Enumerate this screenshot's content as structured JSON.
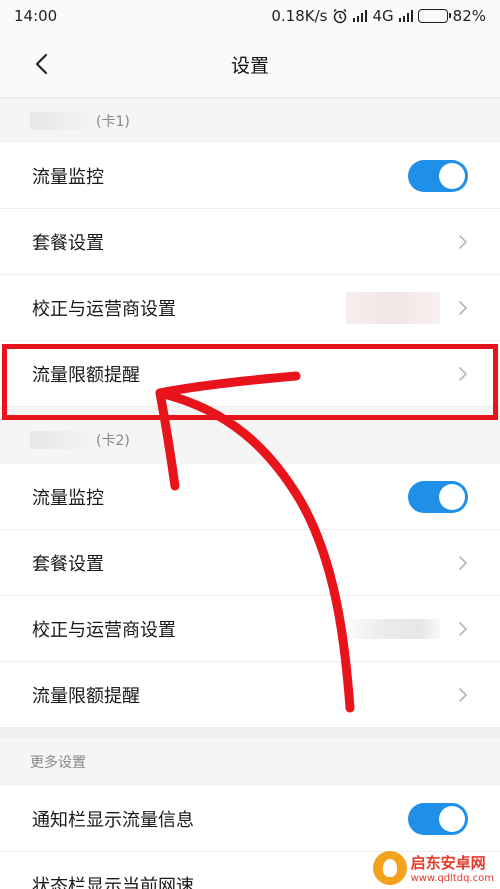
{
  "status_bar": {
    "time": "14:00",
    "speed": "0.18K/s",
    "network": "4G",
    "battery": "82%",
    "battery_level": 0.82
  },
  "header": {
    "title": "设置"
  },
  "sim1": {
    "label": "(卡1)",
    "items": [
      {
        "label": "流量监控",
        "control": "toggle",
        "on": true
      },
      {
        "label": "套餐设置",
        "control": "chevron"
      },
      {
        "label": "校正与运营商设置",
        "control": "chevron"
      },
      {
        "label": "流量限额提醒",
        "control": "chevron"
      }
    ]
  },
  "sim2": {
    "label": "(卡2)",
    "items": [
      {
        "label": "流量监控",
        "control": "toggle",
        "on": true
      },
      {
        "label": "套餐设置",
        "control": "chevron"
      },
      {
        "label": "校正与运营商设置",
        "control": "chevron"
      },
      {
        "label": "流量限额提醒",
        "control": "chevron"
      }
    ]
  },
  "more": {
    "label": "更多设置",
    "items": [
      {
        "label": "通知栏显示流量信息",
        "control": "toggle",
        "on": true
      },
      {
        "label": "状态栏显示当前网速"
      }
    ]
  },
  "watermark": {
    "name": "启东安卓网",
    "url": "www.qdltdq.com"
  },
  "colors": {
    "accent": "#1f8fe8",
    "annotation": "#e8131b"
  }
}
